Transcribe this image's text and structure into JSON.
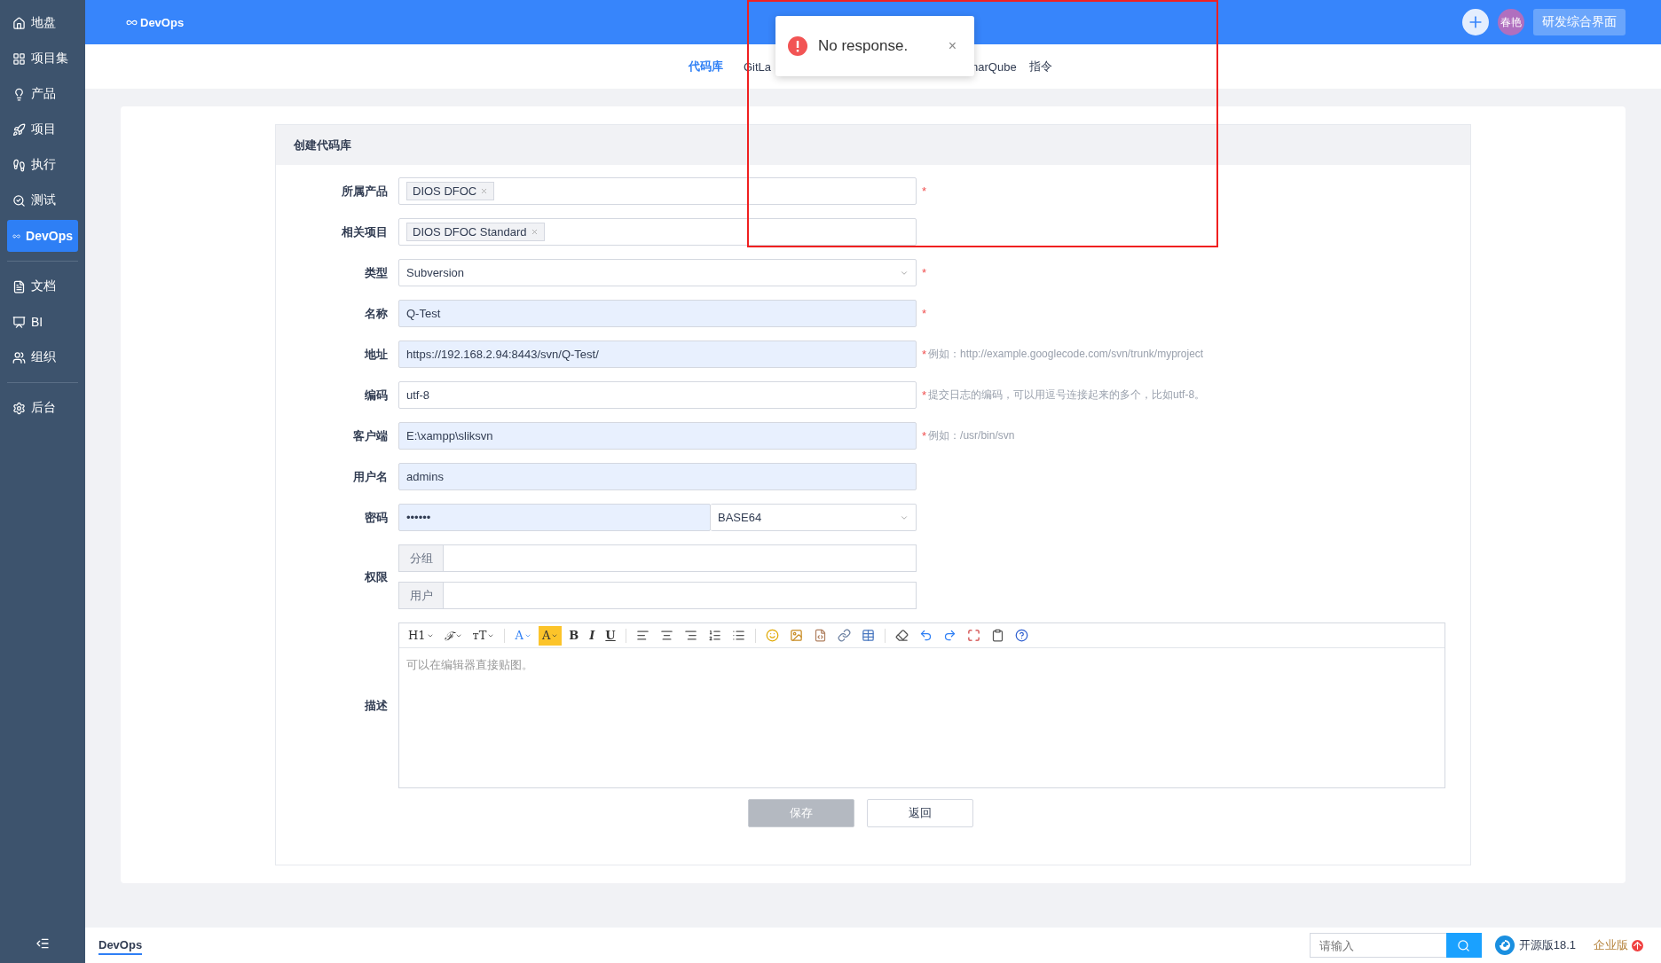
{
  "sidebar": {
    "groups": [
      [
        {
          "label": "地盘",
          "selected": false
        },
        {
          "label": "项目集",
          "selected": false
        },
        {
          "label": "产品",
          "selected": false
        },
        {
          "label": "项目",
          "selected": false
        },
        {
          "label": "执行",
          "selected": false
        },
        {
          "label": "测试",
          "selected": false
        },
        {
          "label": "DevOps",
          "selected": true
        }
      ],
      [
        {
          "label": "文档",
          "selected": false
        },
        {
          "label": "BI",
          "selected": false
        },
        {
          "label": "组织",
          "selected": false
        }
      ],
      [
        {
          "label": "后台",
          "selected": false
        }
      ]
    ]
  },
  "topbar": {
    "title": "DevOps",
    "avatar": "春艳",
    "workspace_button": "研发综合界面"
  },
  "subnav": [
    {
      "label": "代码库",
      "selected": true
    },
    {
      "label": "GitLa",
      "selected": false
    },
    {
      "label": "narQube",
      "selected": false
    },
    {
      "label": "指令",
      "selected": false
    }
  ],
  "toast": {
    "message": "No response.",
    "close": "×"
  },
  "form": {
    "title": "创建代码库",
    "required_mark": "*",
    "fields": [
      {
        "kind": "tags",
        "label": "所属产品",
        "tags": [
          "DIOS DFOC"
        ],
        "required": true
      },
      {
        "kind": "tags",
        "label": "相关项目",
        "tags": [
          "DIOS DFOC Standard"
        ],
        "required": false
      },
      {
        "kind": "select",
        "label": "类型",
        "value": "Subversion",
        "required": true
      },
      {
        "kind": "text",
        "label": "名称",
        "value": "Q-Test",
        "required": true,
        "filled": true
      },
      {
        "kind": "text",
        "label": "地址",
        "value": "https://192.168.2.94:8443/svn/Q-Test/",
        "required": true,
        "filled": true,
        "hint": "例如：http://example.googlecode.com/svn/trunk/myproject"
      },
      {
        "kind": "text",
        "label": "编码",
        "value": "utf-8",
        "required": true,
        "filled": false,
        "hint": "提交日志的编码，可以用逗号连接起来的多个，比如utf-8。"
      },
      {
        "kind": "text",
        "label": "客户端",
        "value": "E:\\xampp\\sliksvn",
        "required": true,
        "filled": true,
        "hint": "例如：/usr/bin/svn"
      },
      {
        "kind": "text",
        "label": "用户名",
        "value": "admins",
        "required": false,
        "filled": true
      },
      {
        "kind": "password",
        "label": "密码",
        "value": "••••••",
        "encoding": "BASE64",
        "required": false
      },
      {
        "kind": "acl",
        "label": "权限",
        "addons": [
          "分组",
          "用户"
        ],
        "required": false
      },
      {
        "kind": "editor",
        "label": "描述",
        "toolbar": [
          "H1",
          "ℱ",
          "ᴛT",
          "A",
          "A",
          "B",
          "I",
          "U"
        ],
        "placeholder": "可以在编辑器直接贴图。",
        "required": false
      }
    ],
    "buttons": [
      {
        "label": "保存",
        "disabled": true
      },
      {
        "label": "返回",
        "disabled": false
      }
    ]
  },
  "footer": {
    "tab": "DevOps",
    "search_placeholder": "请输入",
    "version": "开源版18.1",
    "enterprise": "企业版"
  }
}
